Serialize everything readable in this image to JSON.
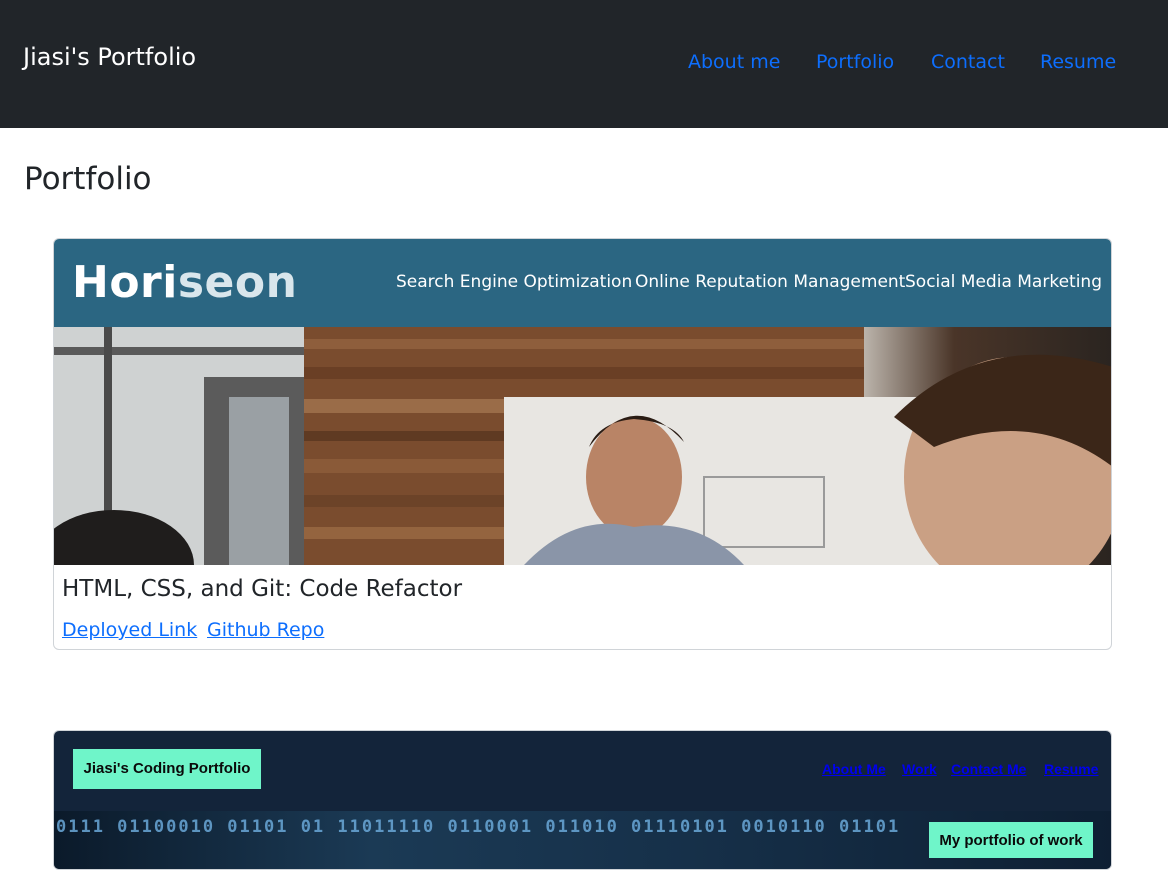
{
  "header": {
    "brand": "Jiasi's Portfolio",
    "nav": [
      "About me",
      "Portfolio",
      "Contact",
      "Resume"
    ]
  },
  "main": {
    "title": "Portfolio",
    "projects": [
      {
        "screenshot": {
          "logo_part1": "Hori",
          "logo_part2": "seon",
          "nav": [
            "Search Engine Optimization",
            "Online Reputation Management",
            "Social Media Marketing"
          ]
        },
        "title": "HTML, CSS, and Git: Code Refactor",
        "links": [
          "Deployed Link",
          "Github Repo"
        ]
      },
      {
        "screenshot": {
          "badge": "Jiasi's Coding Portfolio",
          "nav": [
            "About Me",
            "Work",
            "Contact Me",
            "Resume"
          ],
          "binary": "0111 01100010 01101 01 11011110 0110001 011010 01110101 0010110 01101",
          "banner_badge": "My portfolio of work"
        }
      }
    ]
  },
  "colors": {
    "topbar": "#212529",
    "link": "#0d6efd",
    "horiseon_header": "#2b6682",
    "coding_header": "#13243a",
    "badge": "#6ff5c9"
  }
}
